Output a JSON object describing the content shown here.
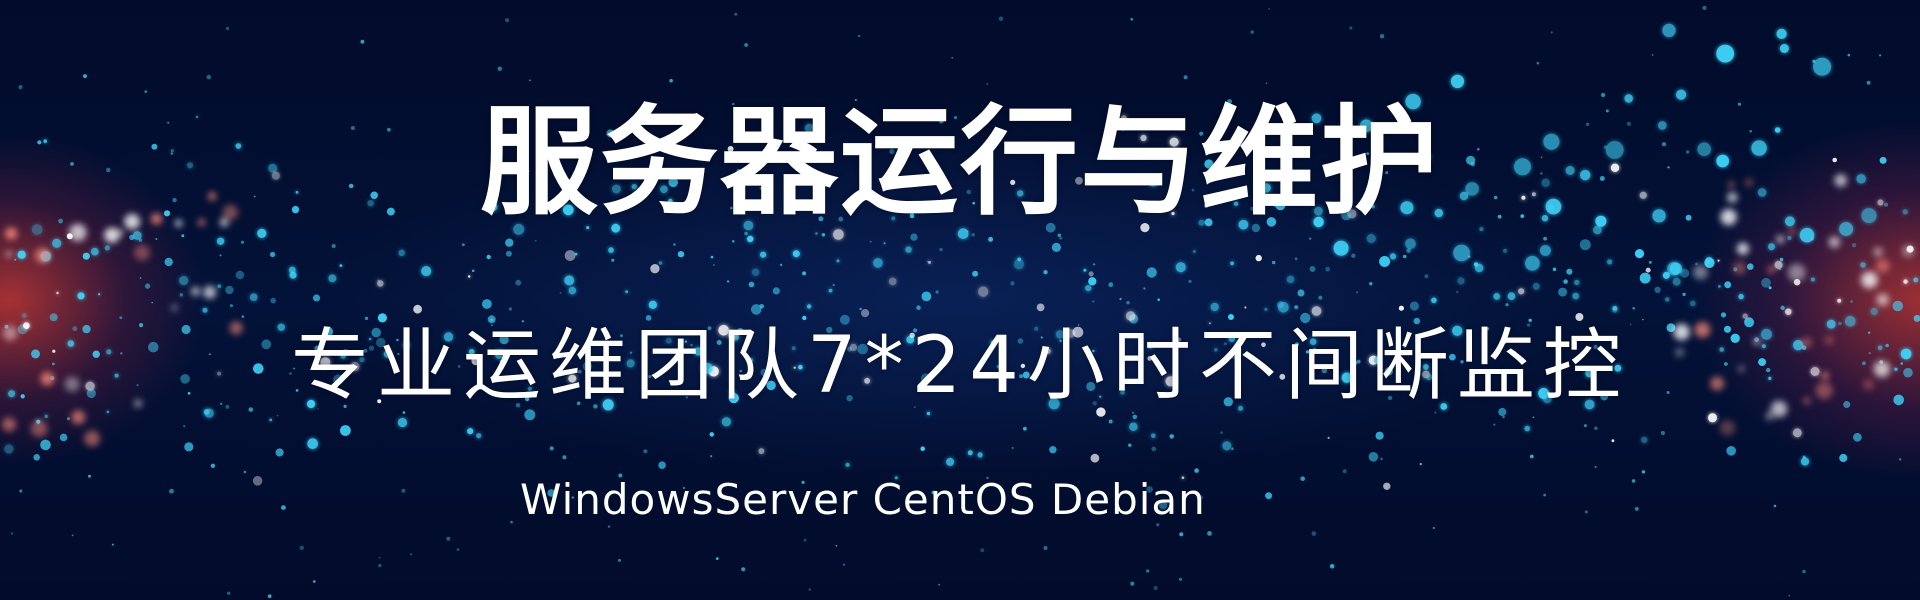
{
  "banner": {
    "title": "服务器运行与维护",
    "subtitle": "专业运维团队7*24小时不间断监控",
    "os_list": "WindowsServer CentOS Debian"
  },
  "colors": {
    "background": "#020c2e",
    "particle_cyan": "#3fd8ff",
    "particle_white": "#ffffff",
    "glow_red": "#dc3c32",
    "text": "#ffffff"
  }
}
